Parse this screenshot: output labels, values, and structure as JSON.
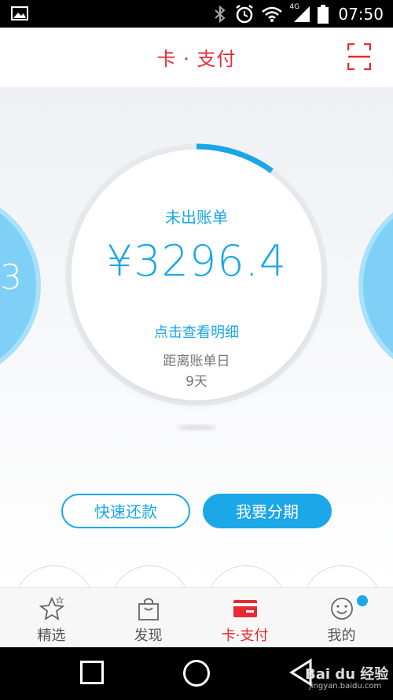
{
  "status_bar": {
    "time": "07:50",
    "network": "4G"
  },
  "header": {
    "title": "卡 · 支付"
  },
  "bill": {
    "label": "未出账单",
    "amount": "¥3296.4",
    "detail_link": "点击查看明细",
    "due_label": "距离账单日",
    "due_days": "9天",
    "progress_fraction": 0.1
  },
  "side_card_left": {
    "text": "3"
  },
  "actions": {
    "repay": "快速还款",
    "installment": "我要分期"
  },
  "tabs": [
    {
      "label": "精选",
      "icon": "star-icon"
    },
    {
      "label": "发现",
      "icon": "bag-icon"
    },
    {
      "label": "卡·支付",
      "icon": "card-icon",
      "active": true
    },
    {
      "label": "我的",
      "icon": "smiley-icon"
    }
  ],
  "watermark": {
    "text": "Bai du 经验",
    "sub": "jingyan.baidu.com"
  },
  "colors": {
    "accent_blue": "#1ba7e8",
    "brand_red": "#e82a33",
    "side_card": "#7fd0f6"
  }
}
